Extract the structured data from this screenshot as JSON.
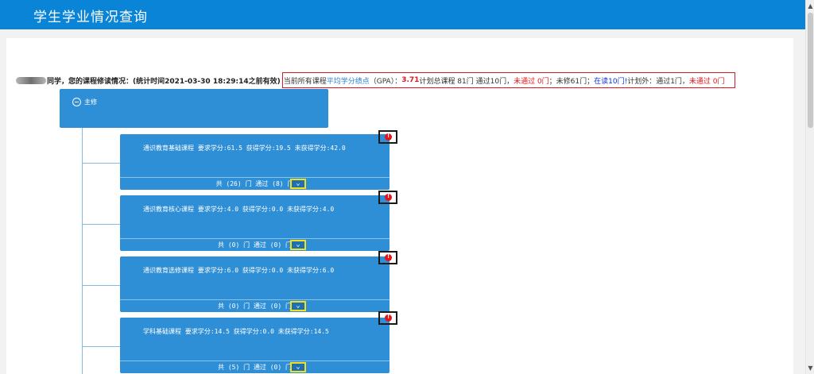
{
  "header": {
    "title": "学生学业情况查询"
  },
  "summary": {
    "lead": "同学，您的课程修读情况：(统计时间2021-03-30 18:29:14之前有效)",
    "stats": {
      "p1": "当前所有课程",
      "gpa_link": "平均学分绩点",
      "p2": "（GPA）：",
      "gpa_value": "3.71",
      "p3": " 计划总课程 81门 通过10门，",
      "not_passed_1": "未通过 0门",
      "p4": "；未修61门；",
      "in_progress": "在读10门!",
      "p5": " 计划外：通过1门，",
      "not_passed_2": "未通过 0门"
    }
  },
  "major": {
    "label": "主修"
  },
  "courses": [
    {
      "desc": "通识教育基础课程  要求学分:61.5  获得学分:19.5   未获得学分:42.0",
      "footer": "共 (26) 门 通过 (8) 门"
    },
    {
      "desc": "通识教育核心课程  要求学分:4.0  获得学分:0.0   未获得学分:4.0",
      "footer": "共 (0) 门 通过 (0) 门"
    },
    {
      "desc": "通识教育选修课程  要求学分:6.0  获得学分:0.0   未获得学分:6.0",
      "footer": "共 (0) 门 通过 (0) 门"
    },
    {
      "desc": "学科基础课程  要求学分:14.5  获得学分:0.0   未获得学分:14.5",
      "footer": "共 (5) 门 通过 (0) 门"
    }
  ],
  "icons": {
    "expand": "chevron-down-icon",
    "alert": "alert-icon",
    "collapse": "minus-circle-icon"
  },
  "colors": {
    "header": "#0a84d6",
    "node": "#2f8fd6",
    "highlight": "#e3161b",
    "button_border": "#f3e01b"
  }
}
